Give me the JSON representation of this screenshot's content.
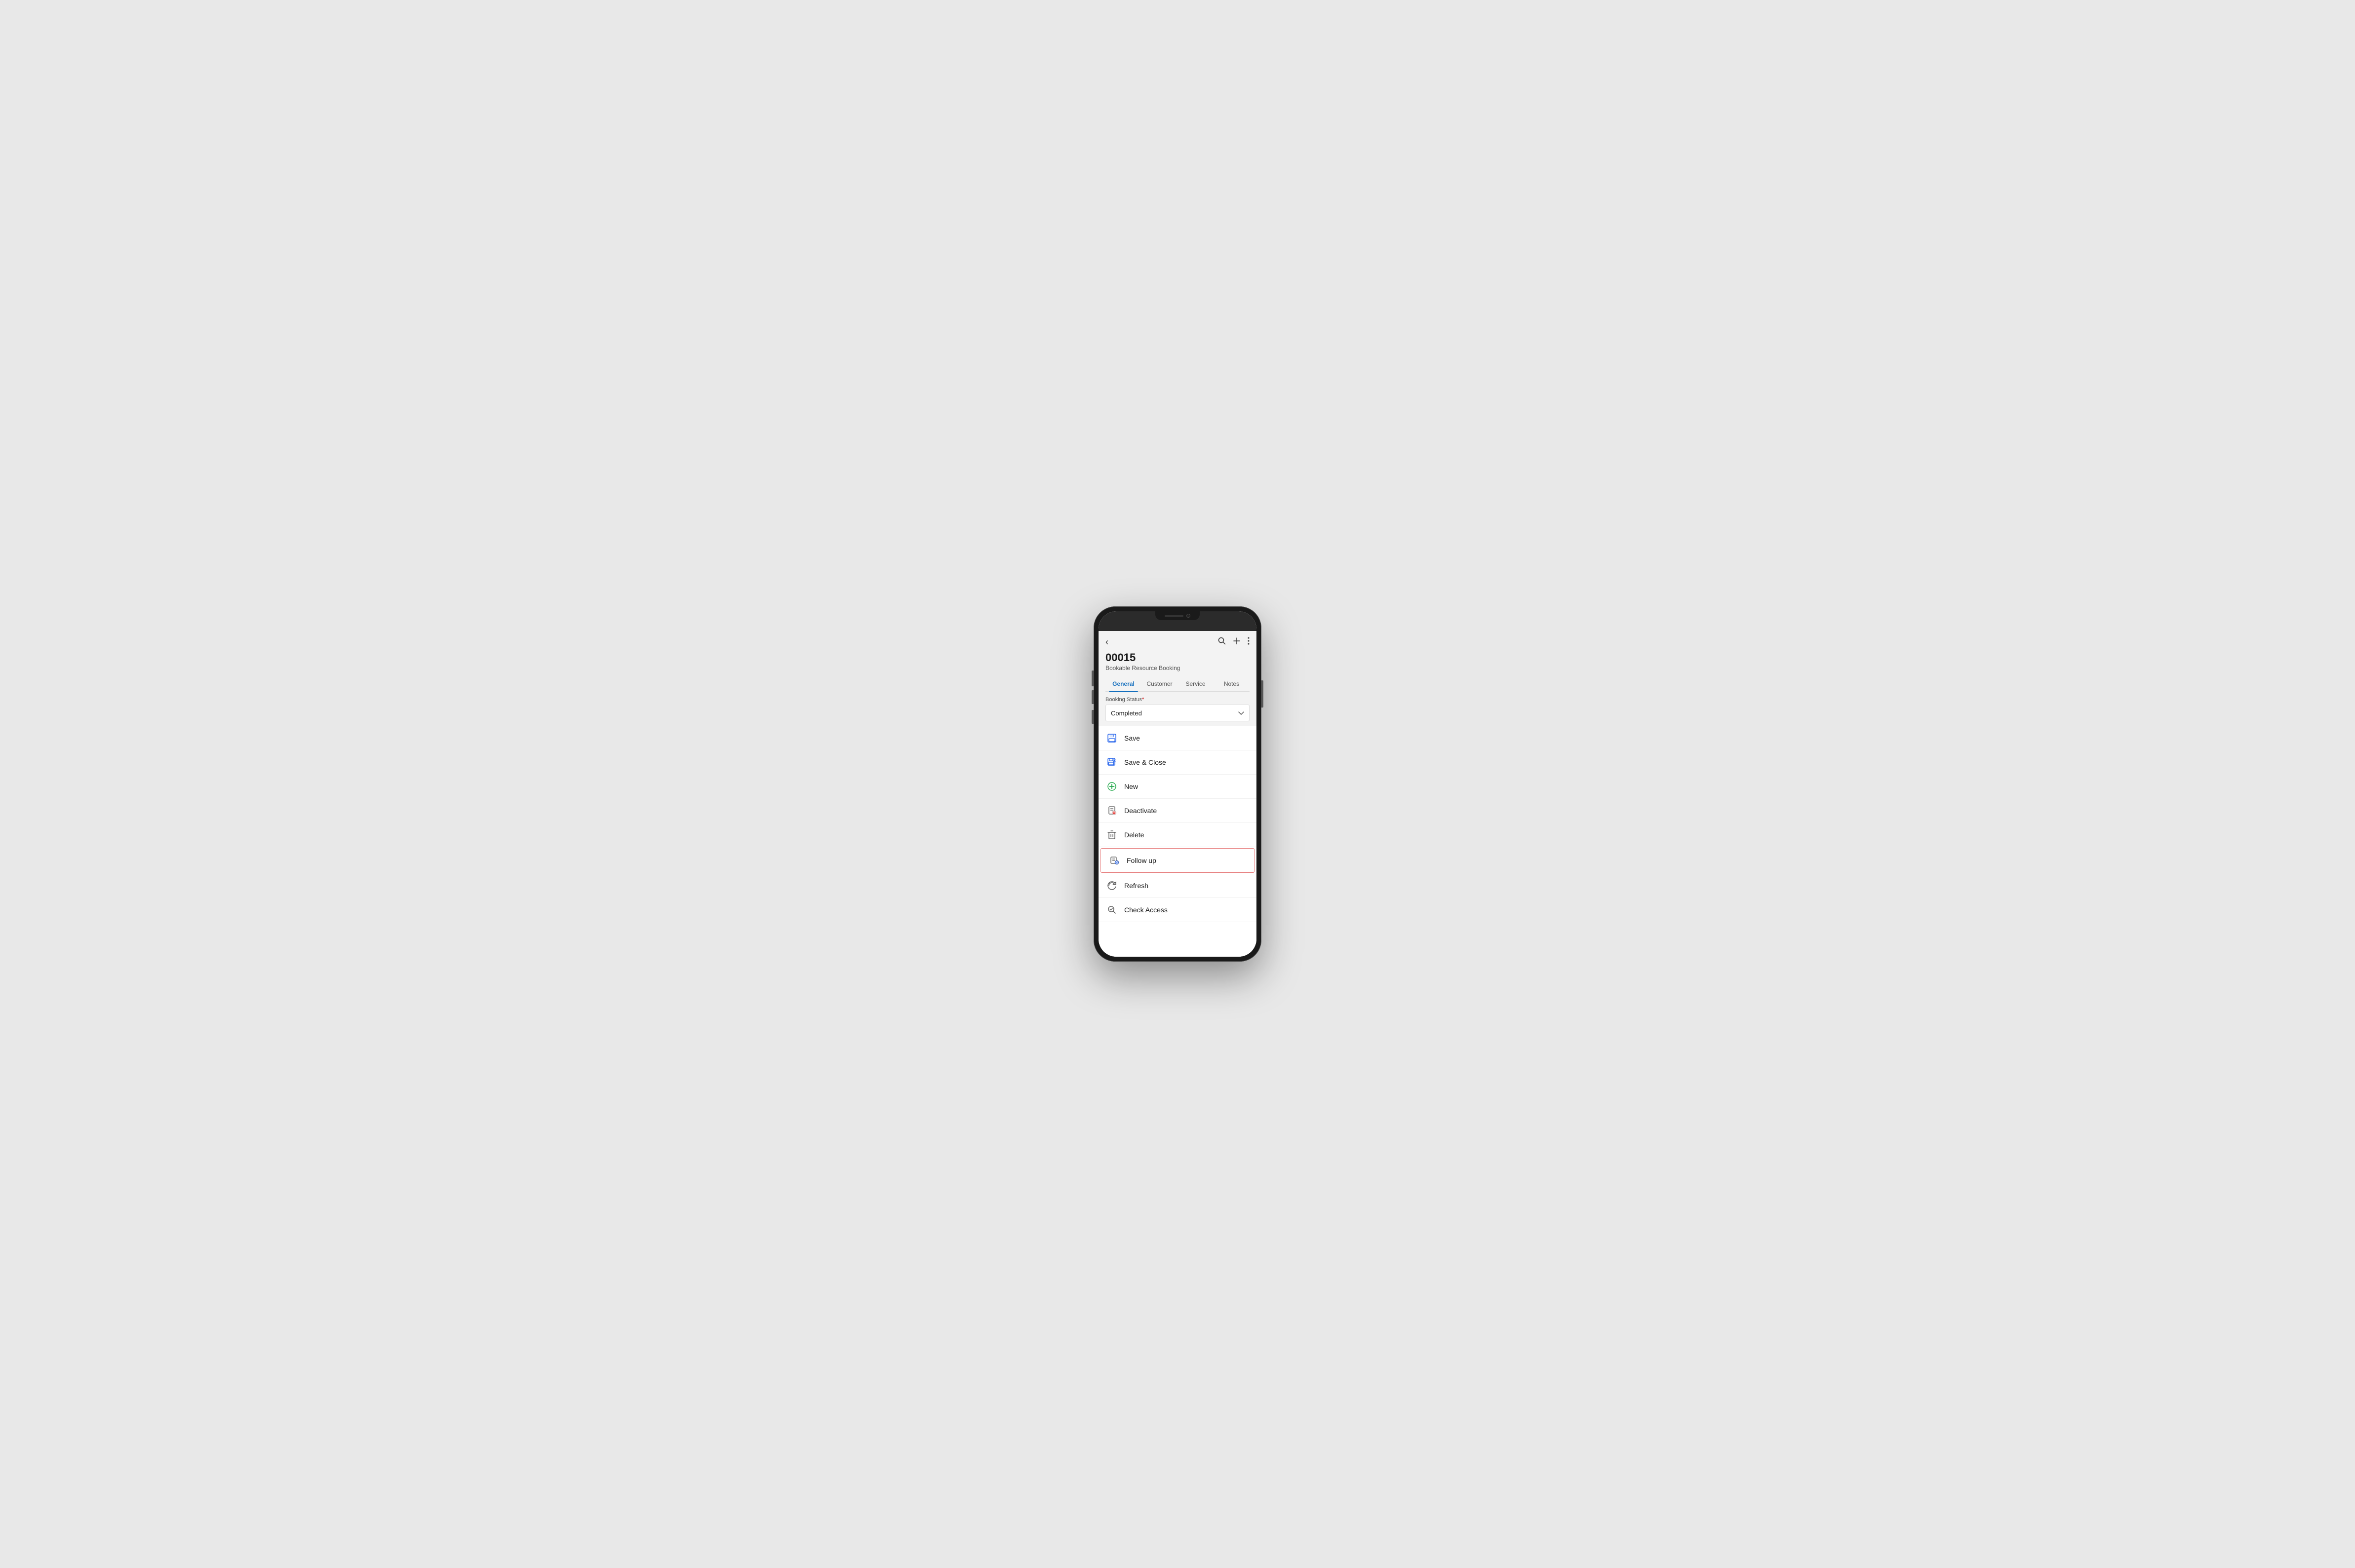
{
  "phone": {
    "notch_speaker_aria": "speaker",
    "notch_camera_aria": "camera"
  },
  "header": {
    "back_label": "‹",
    "search_icon": "🔍",
    "add_icon": "+",
    "more_icon": "⋮",
    "record_id": "00015",
    "record_subtitle": "Bookable Resource Booking"
  },
  "tabs": [
    {
      "id": "general",
      "label": "General",
      "active": true
    },
    {
      "id": "customer",
      "label": "Customer",
      "active": false
    },
    {
      "id": "service",
      "label": "Service",
      "active": false
    },
    {
      "id": "notes",
      "label": "Notes",
      "active": false
    }
  ],
  "booking_status": {
    "label": "Booking Status",
    "required": true,
    "value": "Completed"
  },
  "menu_items": [
    {
      "id": "save",
      "label": "Save",
      "icon": "save",
      "highlighted": false
    },
    {
      "id": "save-close",
      "label": "Save & Close",
      "icon": "save-close",
      "highlighted": false
    },
    {
      "id": "new",
      "label": "New",
      "icon": "new",
      "highlighted": false
    },
    {
      "id": "deactivate",
      "label": "Deactivate",
      "icon": "deactivate",
      "highlighted": false
    },
    {
      "id": "delete",
      "label": "Delete",
      "icon": "delete",
      "highlighted": false
    },
    {
      "id": "follow-up",
      "label": "Follow up",
      "icon": "follow-up",
      "highlighted": true
    },
    {
      "id": "refresh",
      "label": "Refresh",
      "icon": "refresh",
      "highlighted": false
    },
    {
      "id": "check-access",
      "label": "Check Access",
      "icon": "check-access",
      "highlighted": false
    }
  ]
}
